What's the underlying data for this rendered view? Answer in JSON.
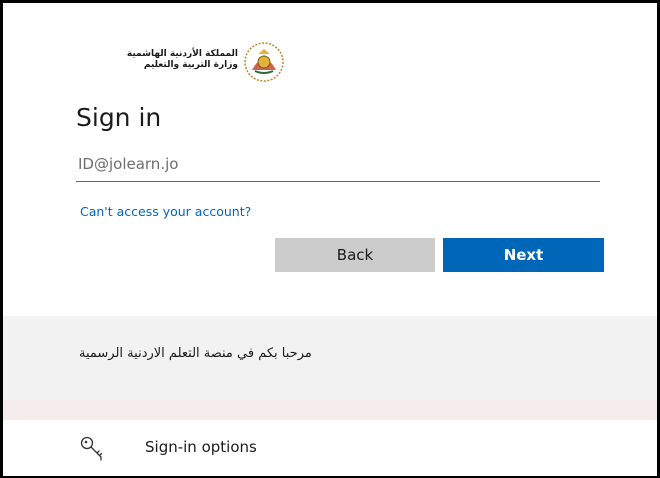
{
  "logo": {
    "line1": "المملكة الأردنية الهاشمية",
    "line2": "وزارة التربية والتعليم"
  },
  "title": "Sign in",
  "email": {
    "placeholder": "ID@jolearn.jo",
    "value": ""
  },
  "help_link": "Can't access your account?",
  "buttons": {
    "back": "Back",
    "next": "Next"
  },
  "welcome": "مرحبا بكم في منصة التعلم الاردنية الرسمية",
  "sign_in_options": "Sign-in options",
  "colors": {
    "accent": "#0067b8",
    "back_button": "#cccccc",
    "band": "#f2f2f2"
  }
}
